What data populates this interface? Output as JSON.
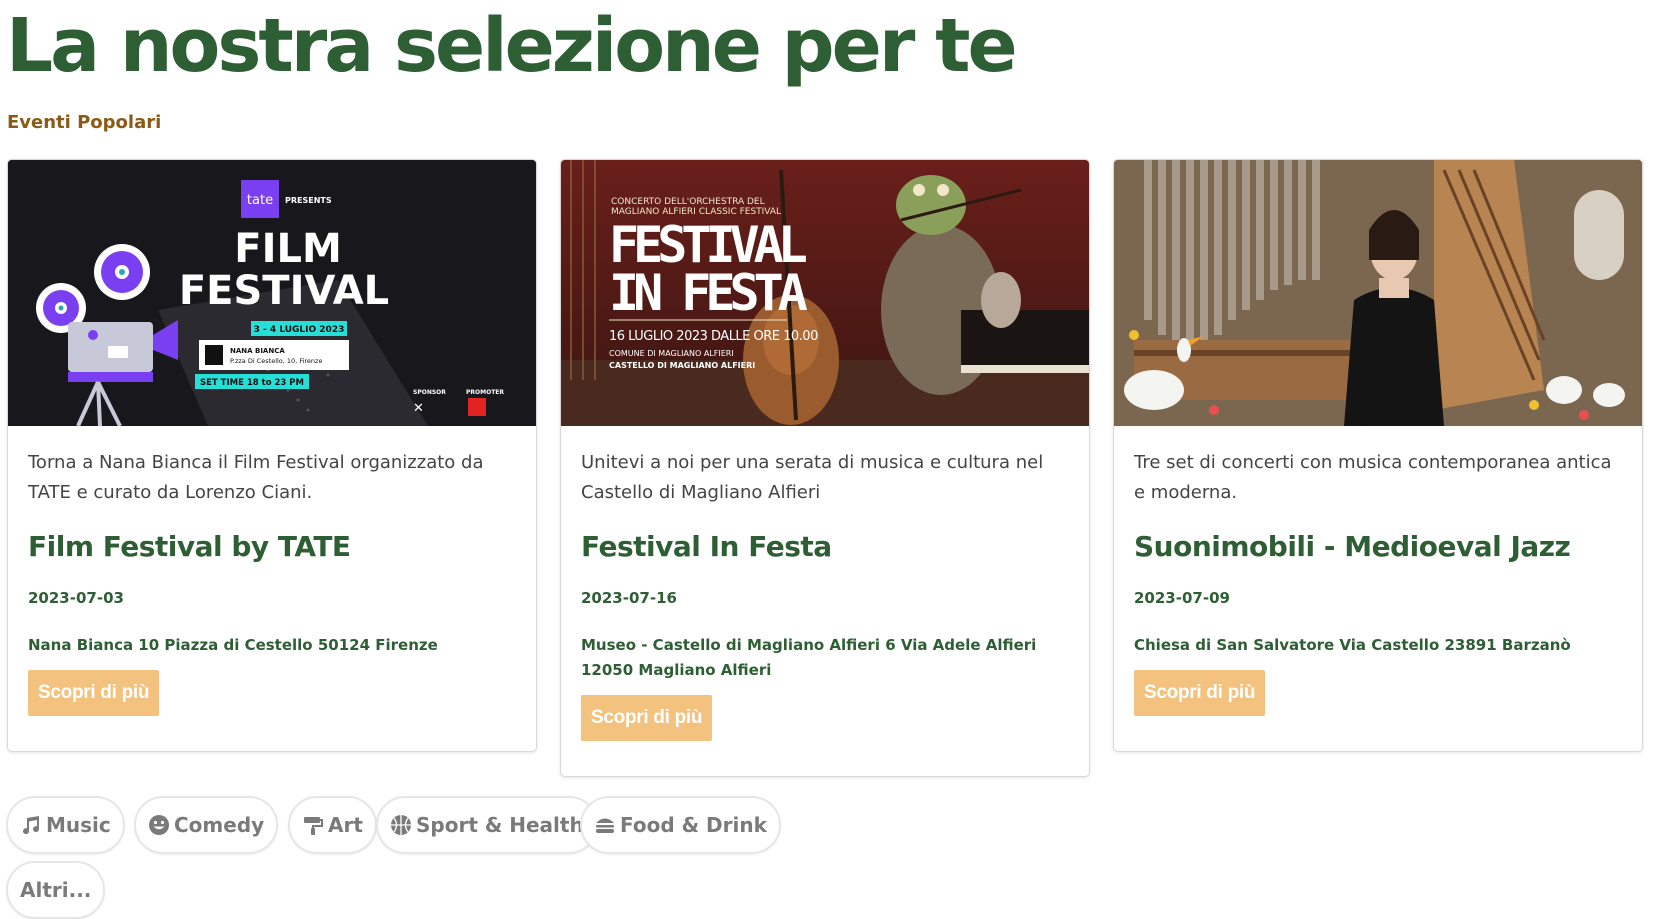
{
  "header": {
    "title": "La nostra selezione per te",
    "subtitle": "Eventi Popolari"
  },
  "cards": [
    {
      "image": {
        "brand": "tate",
        "presents": "PRESENTS",
        "line1": "FILM",
        "line2": "FESTIVAL",
        "dates": "3 - 4 LUGLIO 2023",
        "venue": "NANA BIANCA",
        "address": "P.zza Di Cestello, 10, Firenze",
        "time": "SET TIME 18 to 23 PM",
        "sponsor": "SPONSOR",
        "promoter": "PROMOTER"
      },
      "description": "Torna a Nana Bianca il Film Festival organizzato da TATE e curato da Lorenzo Ciani.",
      "title": "Film Festival by TATE",
      "date": "2023-07-03",
      "location": "Nana Bianca 10 Piazza di Cestello 50124 Firenze",
      "button": "Scopri di più"
    },
    {
      "image": {
        "kicker": "CONCERTO DELL'ORCHESTRA DEL MAGLIANO ALFIERI CLASSIC FESTIVAL",
        "line1": "FESTIVAL",
        "line2": "IN FESTA",
        "datetime": "16 LUGLIO 2023 DALLE ORE 10.00",
        "org": "COMUNE DI MAGLIANO ALFIERI",
        "place": "CASTELLO DI MAGLIANO ALFIERI"
      },
      "description": "Unitevi a noi per una serata di musica e cultura nel Castello di Magliano Alfieri",
      "title": "Festival In Festa",
      "date": "2023-07-16",
      "location": "Museo - Castello di Magliano Alfieri 6 Via Adele Alfieri 12050 Magliano Alfieri",
      "button": "Scopri di più"
    },
    {
      "description": "Tre set di concerti con musica contemporanea antica e moderna.",
      "title": "Suonimobili - Medioeval Jazz",
      "date": "2023-07-09",
      "location": "Chiesa di San Salvatore Via Castello 23891 Barzanò",
      "button": "Scopri di più"
    }
  ],
  "categories": [
    {
      "label": "Music",
      "icon": "music-note-icon"
    },
    {
      "label": "Comedy",
      "icon": "smiley-face-icon"
    },
    {
      "label": "Art",
      "icon": "paint-roller-icon"
    },
    {
      "label": "Sport & Health",
      "icon": "basketball-icon"
    },
    {
      "label": "Food & Drink",
      "icon": "burger-icon"
    },
    {
      "label": "Altri...",
      "icon": ""
    }
  ],
  "colors": {
    "title_green": "#2e5e34",
    "subtitle_brown": "#8a5a17",
    "button_orange": "#f3c27f",
    "chip_text": "#7a7a7a"
  }
}
